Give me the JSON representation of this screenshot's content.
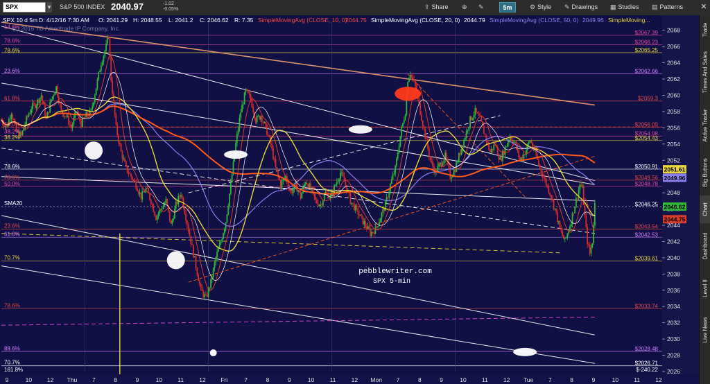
{
  "toolbar": {
    "symbol": "SPX",
    "symbol_name": "S&P 500 INDEX",
    "last_price": "2040.97",
    "net_change": "-1.02",
    "pct_change": "-0.05%",
    "share_label": "Share",
    "timeframe": "5m",
    "style_label": "Style",
    "drawings_label": "Drawings",
    "studies_label": "Studies",
    "patterns_label": "Patterns"
  },
  "sidebar_tabs": [
    "Trade",
    "Times And Sales",
    "Active Trader",
    "Big Buttons",
    "Chart",
    "Dashboard",
    "Level II",
    "Live News"
  ],
  "sidebar_active": "Chart",
  "colors": {
    "background": "#101045",
    "price_bar_up": "#2fb63a",
    "price_bar_down": "#d42a2a",
    "sma10": "#d93a2a",
    "sma20": "#e8d63a",
    "sma50": "#8a7ff0",
    "accent_orange": "#ff5a1a",
    "fib_line": "#c64ac8"
  },
  "chart_data": {
    "type": "candlestick",
    "header": {
      "left": "SPX 10 d 5m",
      "date": "D: 4/12/16 7:30 AM",
      "open": "O: 2041.29",
      "high": "H: 2048.55",
      "low": "L: 2041.2",
      "close": "C: 2046.62",
      "range": "R: 7.35",
      "study1": "SimpleMovingAvg (CLOSE, 10, 0)",
      "study1_value": "2044.75",
      "study2": "SimpleMovingAvg (CLOSE, 20, 0)",
      "study2_value": "2044.79",
      "study3": "SimpleMovingAvg (CLOSE, 50, 0)",
      "study3_value": "2049.96",
      "study4": "SimpleMoving..."
    },
    "watermark": "(c) 2016 TD Ameritrade IP Company, Inc.",
    "annotation": {
      "line1": "pebblewriter.com",
      "line2": "SPX 5-min"
    },
    "ylim": [
      2026,
      2069
    ],
    "y_ticks": [
      2068,
      2066,
      2064,
      2062,
      2060,
      2058,
      2056,
      2054,
      2052,
      2050,
      2048,
      2046,
      2044,
      2042,
      2040,
      2038,
      2036,
      2034,
      2032,
      2030,
      2028,
      2026
    ],
    "x_ticks": [
      "9",
      "10",
      "12",
      "Thu",
      "7",
      "8",
      "9",
      "10",
      "11",
      "12",
      "Fri",
      "7",
      "8",
      "9",
      "10",
      "11",
      "12",
      "Mon",
      "7",
      "8",
      "9",
      "10",
      "11",
      "12",
      "Tue",
      "7",
      "8",
      "9",
      "10",
      "11",
      "12"
    ],
    "right_labels": [
      {
        "text": "$2067.39",
        "value": 2067.39,
        "color": "#e04aa0"
      },
      {
        "text": "$2066.23",
        "value": 2066.23,
        "color": "#e04aa0"
      },
      {
        "text": "$2065.25",
        "value": 2065.25,
        "color": "#e8d63a"
      },
      {
        "text": "$2062.66",
        "value": 2062.66,
        "color": "#d080ff"
      },
      {
        "text": "$2059.3",
        "value": 2059.3,
        "color": "#e04a4a"
      },
      {
        "text": "$2056.09",
        "value": 2056.09,
        "color": "#e04a4a"
      },
      {
        "text": "$2054.98",
        "value": 2054.98,
        "color": "#e04aa0"
      },
      {
        "text": "$2054.43",
        "value": 2054.43,
        "color": "#e8d63a"
      },
      {
        "text": "$2050.91",
        "value": 2050.91,
        "color": "#ffffff"
      },
      {
        "text": "$2049.56",
        "value": 2049.56,
        "color": "#e04a4a"
      },
      {
        "text": "$2048.78",
        "value": 2048.78,
        "color": "#e04aa0"
      },
      {
        "text": "$2046.25",
        "value": 2046.25,
        "color": "#ffffff"
      },
      {
        "text": "$2043.54",
        "value": 2043.54,
        "color": "#e04a4a"
      },
      {
        "text": "$2042.53",
        "value": 2042.53,
        "color": "#d080ff"
      },
      {
        "text": "$2039.61",
        "value": 2039.61,
        "color": "#e8d63a"
      },
      {
        "text": "$2033.74",
        "value": 2033.74,
        "color": "#e04a4a"
      },
      {
        "text": "$2028.48",
        "value": 2028.48,
        "color": "#d080ff"
      },
      {
        "text": "$2026.71",
        "value": 2026.71,
        "color": "#ffffff"
      },
      {
        "text": "$-240.22",
        "value": 2025.9,
        "color": "#ffffff"
      }
    ],
    "left_labels": [
      {
        "text": "14.6%",
        "value": 2068.1,
        "color": "#e04aa0"
      },
      {
        "text": "78.6%",
        "value": 2066.4,
        "color": "#e04aa0"
      },
      {
        "text": "78.6%",
        "value": 2065.2,
        "color": "#e8d63a"
      },
      {
        "text": "23.6%",
        "value": 2062.7,
        "color": "#d080ff"
      },
      {
        "text": "61.8%",
        "value": 2059.3,
        "color": "#e04a4a"
      },
      {
        "text": "50.0%",
        "value": 2056.1,
        "color": "#e04a4a"
      },
      {
        "text": "38.2%",
        "value": 2055.2,
        "color": "#e04aa0"
      },
      {
        "text": "38.2%",
        "value": 2054.5,
        "color": "#e8d63a"
      },
      {
        "text": "78.6%",
        "value": 2050.9,
        "color": "#ffffff"
      },
      {
        "text": "78.6%",
        "value": 2049.6,
        "color": "#e04a4a"
      },
      {
        "text": "50.0%",
        "value": 2048.8,
        "color": "#e04aa0"
      },
      {
        "text": "SMA20",
        "value": 2046.4,
        "color": "#ffffff"
      },
      {
        "text": "23.6%",
        "value": 2043.6,
        "color": "#e04a4a"
      },
      {
        "text": "61.8%",
        "value": 2042.6,
        "color": "#d080ff"
      },
      {
        "text": "70.7%",
        "value": 2039.7,
        "color": "#e8d63a"
      },
      {
        "text": "78.6%",
        "value": 2033.8,
        "color": "#e04a4a"
      },
      {
        "text": "88.6%",
        "value": 2028.5,
        "color": "#d080ff"
      },
      {
        "text": "70.7%",
        "value": 2026.8,
        "color": "#ffffff"
      },
      {
        "text": "161.8%",
        "value": 2025.9,
        "color": "#ffffff"
      }
    ],
    "current_value_tags": [
      {
        "text": "2051.61",
        "value": 2050.9,
        "bg": "#e8d63a",
        "fg": "#000000"
      },
      {
        "text": "2049.96",
        "value": 2049.85,
        "bg": "#8a7ff0",
        "fg": "#000000"
      },
      {
        "text": "2046.62",
        "value": 2046.3,
        "bg": "#2fb63a",
        "fg": "#000000"
      },
      {
        "text": "2044.75",
        "value": 2044.75,
        "bg": "#d93a2a",
        "fg": "#000000"
      }
    ],
    "price_path": [
      [
        0,
        2057
      ],
      [
        4,
        2056
      ],
      [
        8,
        2058
      ],
      [
        12,
        2055.5
      ],
      [
        16,
        2055
      ],
      [
        20,
        2057
      ],
      [
        24,
        2058.5
      ],
      [
        28,
        2059
      ],
      [
        32,
        2060
      ],
      [
        36,
        2057
      ],
      [
        40,
        2059.5
      ],
      [
        44,
        2061
      ],
      [
        48,
        2058
      ],
      [
        52,
        2057.5
      ],
      [
        56,
        2056
      ],
      [
        60,
        2058
      ],
      [
        64,
        2056.5
      ],
      [
        68,
        2057.5
      ],
      [
        72,
        2058
      ],
      [
        76,
        2061
      ],
      [
        80,
        2064
      ],
      [
        84,
        2066
      ],
      [
        86,
        2067.3
      ],
      [
        88,
        2062
      ],
      [
        92,
        2056
      ],
      [
        96,
        2053
      ],
      [
        100,
        2051
      ],
      [
        104,
        2050
      ],
      [
        108,
        2049
      ],
      [
        112,
        2047.5
      ],
      [
        116,
        2048.5
      ],
      [
        120,
        2047
      ],
      [
        124,
        2045
      ],
      [
        128,
        2046
      ],
      [
        132,
        2047
      ],
      [
        136,
        2044
      ],
      [
        140,
        2046.5
      ],
      [
        144,
        2048
      ],
      [
        148,
        2045
      ],
      [
        152,
        2042
      ],
      [
        156,
        2039
      ],
      [
        160,
        2036
      ],
      [
        164,
        2035
      ],
      [
        168,
        2037
      ],
      [
        172,
        2040
      ],
      [
        176,
        2042
      ],
      [
        180,
        2044.5
      ],
      [
        184,
        2049
      ],
      [
        188,
        2054
      ],
      [
        192,
        2058
      ],
      [
        196,
        2060.5
      ],
      [
        200,
        2059.5
      ],
      [
        204,
        2057
      ],
      [
        208,
        2057.5
      ],
      [
        212,
        2056
      ],
      [
        216,
        2054
      ],
      [
        220,
        2051
      ],
      [
        224,
        2049
      ],
      [
        228,
        2050
      ],
      [
        232,
        2048
      ],
      [
        236,
        2049
      ],
      [
        240,
        2047.5
      ],
      [
        244,
        2049.5
      ],
      [
        248,
        2048.5
      ],
      [
        252,
        2047
      ],
      [
        256,
        2046.5
      ],
      [
        260,
        2048
      ],
      [
        264,
        2047.5
      ],
      [
        268,
        2049
      ],
      [
        272,
        2050.5
      ],
      [
        276,
        2049
      ],
      [
        280,
        2047
      ],
      [
        284,
        2046
      ],
      [
        288,
        2045
      ],
      [
        292,
        2044
      ],
      [
        296,
        2043
      ],
      [
        300,
        2043.5
      ],
      [
        304,
        2045
      ],
      [
        308,
        2046.5
      ],
      [
        312,
        2049
      ],
      [
        316,
        2051
      ],
      [
        320,
        2055
      ],
      [
        324,
        2058
      ],
      [
        326,
        2062
      ],
      [
        328,
        2062.8
      ],
      [
        332,
        2061
      ],
      [
        336,
        2058
      ],
      [
        340,
        2055
      ],
      [
        344,
        2052
      ],
      [
        348,
        2050.5
      ],
      [
        352,
        2051.5
      ],
      [
        356,
        2052.5
      ],
      [
        360,
        2050
      ],
      [
        364,
        2051
      ],
      [
        368,
        2053
      ],
      [
        372,
        2055
      ],
      [
        376,
        2057
      ],
      [
        380,
        2058
      ],
      [
        384,
        2057
      ],
      [
        388,
        2055
      ],
      [
        392,
        2053
      ],
      [
        396,
        2054
      ],
      [
        400,
        2052
      ],
      [
        404,
        2053.5
      ],
      [
        408,
        2055
      ],
      [
        412,
        2054
      ],
      [
        416,
        2052
      ],
      [
        420,
        2053
      ],
      [
        424,
        2054.5
      ],
      [
        428,
        2053
      ],
      [
        432,
        2051
      ],
      [
        436,
        2049.5
      ],
      [
        440,
        2048
      ],
      [
        444,
        2046
      ],
      [
        448,
        2043.5
      ],
      [
        452,
        2042
      ],
      [
        456,
        2044
      ],
      [
        460,
        2046.5
      ],
      [
        464,
        2049
      ],
      [
        466,
        2048.5
      ],
      [
        468,
        2045
      ],
      [
        470,
        2042
      ],
      [
        472,
        2040.5
      ],
      [
        474,
        2042
      ],
      [
        476,
        2046.6
      ]
    ],
    "series": [
      {
        "name": "SimpleMovingAvg (CLOSE, 10, 0)",
        "value": 2044.75
      },
      {
        "name": "SimpleMovingAvg (CLOSE, 20, 0)",
        "value": 2044.79
      },
      {
        "name": "SimpleMovingAvg (CLOSE, 50, 0)",
        "value": 2049.96
      }
    ],
    "trendlines": [
      {
        "name": "white-down-upper",
        "color": "#ffffff",
        "dash": "",
        "points": [
          [
            0,
            2068.5
          ],
          [
            476,
            2049.5
          ]
        ]
      },
      {
        "name": "white-down-mid",
        "color": "#ffffff",
        "dash": "",
        "points": [
          [
            0,
            2061.5
          ],
          [
            476,
            2049
          ]
        ]
      },
      {
        "name": "white-down-lower",
        "color": "#ffffff",
        "dash": "",
        "points": [
          [
            0,
            2045.2
          ],
          [
            476,
            2030.5
          ]
        ]
      },
      {
        "name": "white-down-bottom",
        "color": "#ffffff",
        "dash": "",
        "points": [
          [
            0,
            2039
          ],
          [
            476,
            2027
          ]
        ]
      },
      {
        "name": "white-down-channel",
        "color": "#ffffff",
        "dash": "",
        "points": [
          [
            0,
            2050
          ],
          [
            476,
            2047
          ]
        ]
      },
      {
        "name": "white-dashed-down",
        "color": "#ffffff",
        "dash": "6,4",
        "points": [
          [
            0,
            2053.5
          ],
          [
            476,
            2043
          ]
        ]
      },
      {
        "name": "white-dashed-up",
        "color": "#ffffff",
        "dash": "6,4",
        "points": [
          [
            150,
            2048
          ],
          [
            400,
            2057.5
          ]
        ]
      },
      {
        "name": "orange-resistance",
        "color": "#f0a070",
        "dash": "",
        "points": [
          [
            0,
            2069
          ],
          [
            476,
            2058.8
          ]
        ]
      },
      {
        "name": "red-dashed-up",
        "color": "#ff5a1a",
        "dash": "5,3",
        "points": [
          [
            150,
            2037
          ],
          [
            476,
            2052.5
          ]
        ]
      },
      {
        "name": "red-dashed-down",
        "color": "#ff5a1a",
        "dash": "5,3",
        "points": [
          [
            326,
            2062.6
          ],
          [
            420,
            2047.5
          ]
        ]
      },
      {
        "name": "yellow-dashed",
        "color": "#e8d63a",
        "dash": "6,4",
        "points": [
          [
            0,
            2043
          ],
          [
            450,
            2040.6
          ]
        ]
      },
      {
        "name": "magenta-dashed",
        "color": "#e04ad0",
        "dash": "6,4",
        "points": [
          [
            0,
            2031.7
          ],
          [
            476,
            2032.7
          ]
        ]
      }
    ],
    "markers": [
      {
        "name": "circle-thu-7",
        "t": 74,
        "v": 2053.2
      },
      {
        "name": "circle-thu-11",
        "t": 140,
        "v": 2039.7
      },
      {
        "name": "oval-fri-7",
        "t": 188,
        "v": 2052.7
      },
      {
        "name": "oval-mon-7",
        "t": 288,
        "v": 2055.8
      },
      {
        "name": "oval-mon-red",
        "t": 326,
        "v": 2060.2
      },
      {
        "name": "oval-tue-9",
        "t": 420,
        "v": 2028.4
      },
      {
        "name": "dot-fri-1",
        "t": 170,
        "v": 2028.3
      }
    ]
  }
}
